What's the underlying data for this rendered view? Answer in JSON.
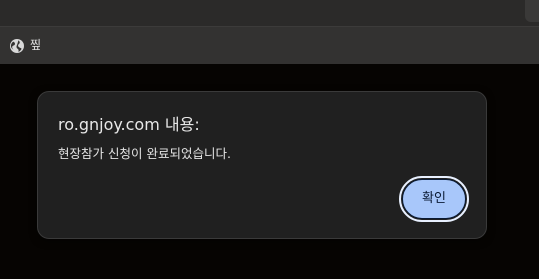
{
  "browser": {
    "bookmark": {
      "icon": "globe-icon",
      "label": "찦"
    }
  },
  "dialog": {
    "title": "ro.gnjoy.com 내용:",
    "message": "현장참가 신청이 완료되었습니다.",
    "ok_label": "확인",
    "accent_color": "#a8c7fa",
    "background_color": "#202020"
  }
}
